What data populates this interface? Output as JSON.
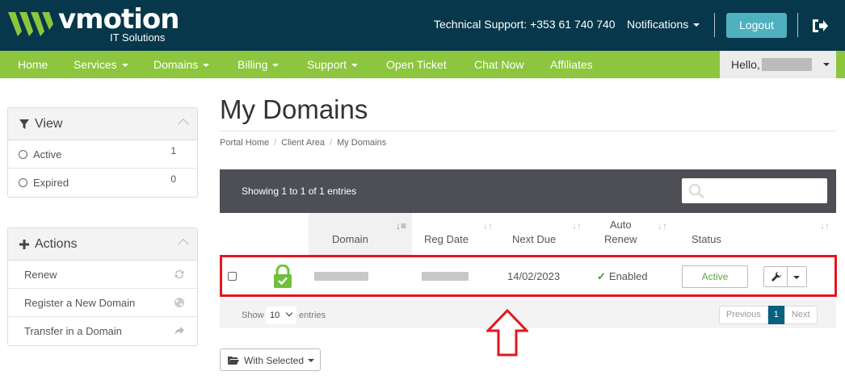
{
  "header": {
    "logo_word": "vmotion",
    "logo_sub": "IT Solutions",
    "support": "Technical Support: +353 61 740 740",
    "notifications": "Notifications",
    "logout": "Logout"
  },
  "nav": {
    "items": [
      "Home",
      "Services",
      "Domains",
      "Billing",
      "Support",
      "Open Ticket",
      "Chat Now",
      "Affiliates"
    ],
    "hello": "Hello,"
  },
  "sidebar": {
    "view": {
      "title": "View",
      "items": [
        {
          "label": "Active",
          "count": "1"
        },
        {
          "label": "Expired",
          "count": "0"
        }
      ]
    },
    "actions": {
      "title": "Actions",
      "items": [
        {
          "label": "Renew",
          "icon": "refresh-icon"
        },
        {
          "label": "Register a New Domain",
          "icon": "globe-icon"
        },
        {
          "label": "Transfer in a Domain",
          "icon": "share-icon"
        }
      ]
    }
  },
  "main": {
    "title": "My Domains",
    "breadcrumb": [
      "Portal Home",
      "Client Area",
      "My Domains"
    ],
    "showing": "Showing 1 to 1 of 1 entries",
    "search_placeholder": "",
    "columns": {
      "domain": "Domain",
      "reg_date": "Reg Date",
      "next_due": "Next Due",
      "auto_renew_1": "Auto",
      "auto_renew_2": "Renew",
      "status": "Status"
    },
    "row": {
      "next_due": "14/02/2023",
      "auto_renew": "Enabled",
      "status": "Active"
    },
    "footer": {
      "show": "Show",
      "length": "10",
      "entries": "entries",
      "prev": "Previous",
      "page": "1",
      "next": "Next"
    },
    "with_selected": "With Selected"
  },
  "colors": {
    "header_bg": "#06374a",
    "nav_bg": "#8cc63e",
    "accent": "#4fb0bf",
    "highlight": "#e3171e",
    "active_green": "#5aab31"
  }
}
